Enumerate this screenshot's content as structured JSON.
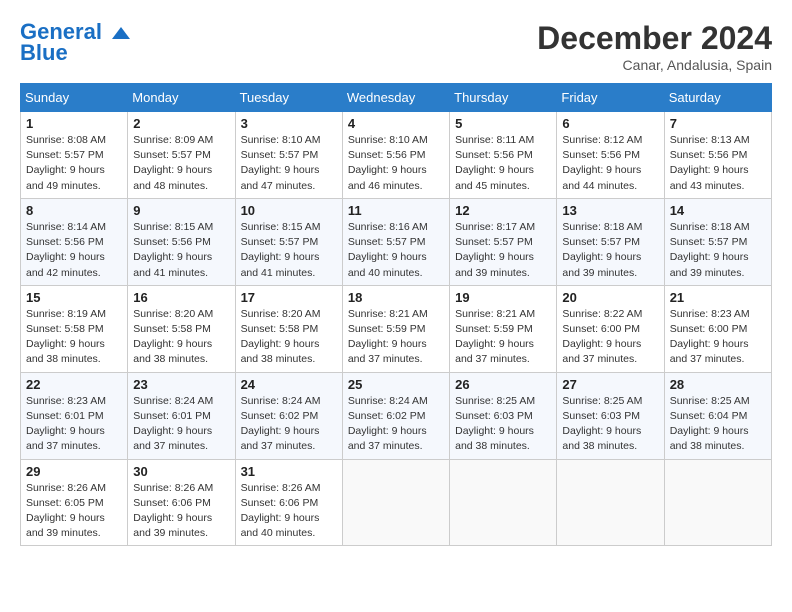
{
  "header": {
    "logo_line1": "General",
    "logo_line2": "Blue",
    "month": "December 2024",
    "location": "Canar, Andalusia, Spain"
  },
  "weekdays": [
    "Sunday",
    "Monday",
    "Tuesday",
    "Wednesday",
    "Thursday",
    "Friday",
    "Saturday"
  ],
  "weeks": [
    [
      {
        "day": "1",
        "sunrise": "8:08 AM",
        "sunset": "5:57 PM",
        "daylight": "9 hours and 49 minutes."
      },
      {
        "day": "2",
        "sunrise": "8:09 AM",
        "sunset": "5:57 PM",
        "daylight": "9 hours and 48 minutes."
      },
      {
        "day": "3",
        "sunrise": "8:10 AM",
        "sunset": "5:57 PM",
        "daylight": "9 hours and 47 minutes."
      },
      {
        "day": "4",
        "sunrise": "8:10 AM",
        "sunset": "5:56 PM",
        "daylight": "9 hours and 46 minutes."
      },
      {
        "day": "5",
        "sunrise": "8:11 AM",
        "sunset": "5:56 PM",
        "daylight": "9 hours and 45 minutes."
      },
      {
        "day": "6",
        "sunrise": "8:12 AM",
        "sunset": "5:56 PM",
        "daylight": "9 hours and 44 minutes."
      },
      {
        "day": "7",
        "sunrise": "8:13 AM",
        "sunset": "5:56 PM",
        "daylight": "9 hours and 43 minutes."
      }
    ],
    [
      {
        "day": "8",
        "sunrise": "8:14 AM",
        "sunset": "5:56 PM",
        "daylight": "9 hours and 42 minutes."
      },
      {
        "day": "9",
        "sunrise": "8:15 AM",
        "sunset": "5:56 PM",
        "daylight": "9 hours and 41 minutes."
      },
      {
        "day": "10",
        "sunrise": "8:15 AM",
        "sunset": "5:57 PM",
        "daylight": "9 hours and 41 minutes."
      },
      {
        "day": "11",
        "sunrise": "8:16 AM",
        "sunset": "5:57 PM",
        "daylight": "9 hours and 40 minutes."
      },
      {
        "day": "12",
        "sunrise": "8:17 AM",
        "sunset": "5:57 PM",
        "daylight": "9 hours and 39 minutes."
      },
      {
        "day": "13",
        "sunrise": "8:18 AM",
        "sunset": "5:57 PM",
        "daylight": "9 hours and 39 minutes."
      },
      {
        "day": "14",
        "sunrise": "8:18 AM",
        "sunset": "5:57 PM",
        "daylight": "9 hours and 39 minutes."
      }
    ],
    [
      {
        "day": "15",
        "sunrise": "8:19 AM",
        "sunset": "5:58 PM",
        "daylight": "9 hours and 38 minutes."
      },
      {
        "day": "16",
        "sunrise": "8:20 AM",
        "sunset": "5:58 PM",
        "daylight": "9 hours and 38 minutes."
      },
      {
        "day": "17",
        "sunrise": "8:20 AM",
        "sunset": "5:58 PM",
        "daylight": "9 hours and 38 minutes."
      },
      {
        "day": "18",
        "sunrise": "8:21 AM",
        "sunset": "5:59 PM",
        "daylight": "9 hours and 37 minutes."
      },
      {
        "day": "19",
        "sunrise": "8:21 AM",
        "sunset": "5:59 PM",
        "daylight": "9 hours and 37 minutes."
      },
      {
        "day": "20",
        "sunrise": "8:22 AM",
        "sunset": "6:00 PM",
        "daylight": "9 hours and 37 minutes."
      },
      {
        "day": "21",
        "sunrise": "8:23 AM",
        "sunset": "6:00 PM",
        "daylight": "9 hours and 37 minutes."
      }
    ],
    [
      {
        "day": "22",
        "sunrise": "8:23 AM",
        "sunset": "6:01 PM",
        "daylight": "9 hours and 37 minutes."
      },
      {
        "day": "23",
        "sunrise": "8:24 AM",
        "sunset": "6:01 PM",
        "daylight": "9 hours and 37 minutes."
      },
      {
        "day": "24",
        "sunrise": "8:24 AM",
        "sunset": "6:02 PM",
        "daylight": "9 hours and 37 minutes."
      },
      {
        "day": "25",
        "sunrise": "8:24 AM",
        "sunset": "6:02 PM",
        "daylight": "9 hours and 37 minutes."
      },
      {
        "day": "26",
        "sunrise": "8:25 AM",
        "sunset": "6:03 PM",
        "daylight": "9 hours and 38 minutes."
      },
      {
        "day": "27",
        "sunrise": "8:25 AM",
        "sunset": "6:03 PM",
        "daylight": "9 hours and 38 minutes."
      },
      {
        "day": "28",
        "sunrise": "8:25 AM",
        "sunset": "6:04 PM",
        "daylight": "9 hours and 38 minutes."
      }
    ],
    [
      {
        "day": "29",
        "sunrise": "8:26 AM",
        "sunset": "6:05 PM",
        "daylight": "9 hours and 39 minutes."
      },
      {
        "day": "30",
        "sunrise": "8:26 AM",
        "sunset": "6:06 PM",
        "daylight": "9 hours and 39 minutes."
      },
      {
        "day": "31",
        "sunrise": "8:26 AM",
        "sunset": "6:06 PM",
        "daylight": "9 hours and 40 minutes."
      },
      null,
      null,
      null,
      null
    ]
  ]
}
